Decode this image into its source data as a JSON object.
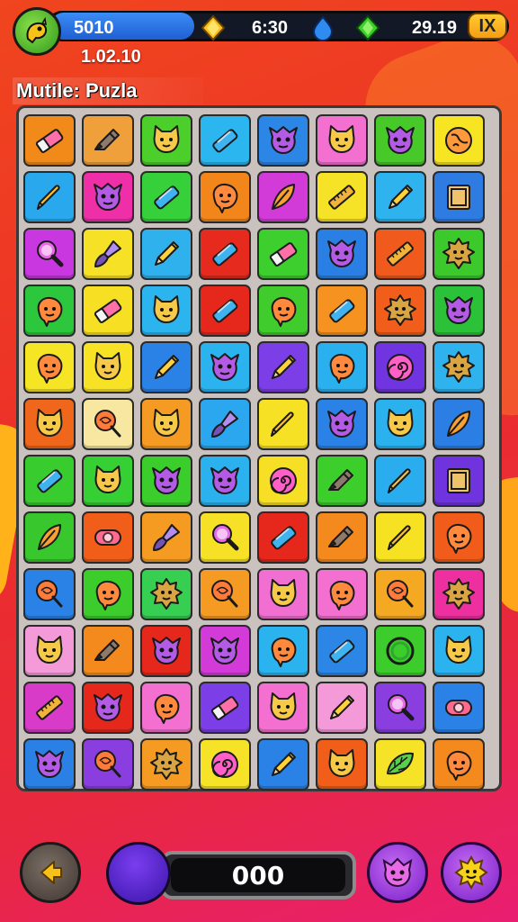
{
  "hud": {
    "score": "5010",
    "subscore": "1.02.10",
    "timer": "6:30",
    "gems": "29.19",
    "close_label": "IX"
  },
  "mode_title": "Mutile: Puzla",
  "board": {
    "rows": [
      [
        {
          "bg": "#f28a1a",
          "icon": "eraser-icon"
        },
        {
          "bg": "#f0a03a",
          "icon": "marker-icon"
        },
        {
          "bg": "#4ccf2a",
          "icon": "cat-face-icon"
        },
        {
          "bg": "#2bb6f0",
          "icon": "crayon-icon"
        },
        {
          "bg": "#2b86e6",
          "icon": "monster-icon"
        },
        {
          "bg": "#f36fd0",
          "icon": "cat-face-icon"
        },
        {
          "bg": "#48c92a",
          "icon": "monster-icon"
        },
        {
          "bg": "#f7e423",
          "icon": "globe-icon"
        }
      ],
      [
        {
          "bg": "#2aa8ee",
          "icon": "pen-icon"
        },
        {
          "bg": "#ee2fa8",
          "icon": "monster-icon"
        },
        {
          "bg": "#36d03a",
          "icon": "crayon-icon"
        },
        {
          "bg": "#f2861a",
          "icon": "blob-face-icon"
        },
        {
          "bg": "#d33bd8",
          "icon": "feather-icon"
        },
        {
          "bg": "#f6e226",
          "icon": "ruler-icon"
        },
        {
          "bg": "#2fb3ef",
          "icon": "pencil-icon"
        },
        {
          "bg": "#2e7be2",
          "icon": "book-icon"
        }
      ],
      [
        {
          "bg": "#c937e0",
          "icon": "magnifier-icon"
        },
        {
          "bg": "#f7e126",
          "icon": "brush-icon"
        },
        {
          "bg": "#2fb1ee",
          "icon": "pencil-icon"
        },
        {
          "bg": "#e62a1e",
          "icon": "crayon-icon"
        },
        {
          "bg": "#3ccf2e",
          "icon": "eraser-icon"
        },
        {
          "bg": "#2a7fe4",
          "icon": "monster-icon"
        },
        {
          "bg": "#f05a1c",
          "icon": "ruler-icon"
        },
        {
          "bg": "#3bc92c",
          "icon": "sun-face-icon"
        }
      ],
      [
        {
          "bg": "#2cc73c",
          "icon": "blob-face-icon"
        },
        {
          "bg": "#f7e023",
          "icon": "eraser-icon"
        },
        {
          "bg": "#2cb4ee",
          "icon": "cat-face-icon"
        },
        {
          "bg": "#e6281c",
          "icon": "crayon-icon"
        },
        {
          "bg": "#3fcc2c",
          "icon": "blob-face-icon"
        },
        {
          "bg": "#f59220",
          "icon": "crayon-icon"
        },
        {
          "bg": "#f15d1a",
          "icon": "sun-face-icon"
        },
        {
          "bg": "#2bc23a",
          "icon": "monster-icon"
        }
      ],
      [
        {
          "bg": "#f6e524",
          "icon": "blob-face-icon"
        },
        {
          "bg": "#f7e226",
          "icon": "cat-face-icon"
        },
        {
          "bg": "#2b82e6",
          "icon": "pencil-icon"
        },
        {
          "bg": "#2ab3ef",
          "icon": "monster-icon"
        },
        {
          "bg": "#7c3ee6",
          "icon": "pencil-icon"
        },
        {
          "bg": "#2ab0ee",
          "icon": "blob-face-icon"
        },
        {
          "bg": "#7035e0",
          "icon": "swirl-icon"
        },
        {
          "bg": "#2eb3ef",
          "icon": "sun-face-icon"
        }
      ],
      [
        {
          "bg": "#f0661a",
          "icon": "cat-face-icon"
        },
        {
          "bg": "#f7e7a0",
          "icon": "lollipop-icon"
        },
        {
          "bg": "#f59a22",
          "icon": "cat-face-icon"
        },
        {
          "bg": "#2aa7ee",
          "icon": "brush-icon"
        },
        {
          "bg": "#f6e125",
          "icon": "pen-icon"
        },
        {
          "bg": "#2b82e6",
          "icon": "monster-icon"
        },
        {
          "bg": "#2ab1ee",
          "icon": "cat-face-icon"
        },
        {
          "bg": "#2b7fe4",
          "icon": "feather-icon"
        }
      ],
      [
        {
          "bg": "#38cc2e",
          "icon": "crayon-icon"
        },
        {
          "bg": "#36cf34",
          "icon": "cat-face-icon"
        },
        {
          "bg": "#3acd2c",
          "icon": "monster-icon"
        },
        {
          "bg": "#2ab1ee",
          "icon": "monster-icon"
        },
        {
          "bg": "#f6df24",
          "icon": "swirl-icon"
        },
        {
          "bg": "#3ccf2c",
          "icon": "marker-icon"
        },
        {
          "bg": "#2aadee",
          "icon": "pen-icon"
        },
        {
          "bg": "#7034de",
          "icon": "book-icon"
        }
      ],
      [
        {
          "bg": "#38c72c",
          "icon": "feather-icon"
        },
        {
          "bg": "#f05e1a",
          "icon": "tape-icon"
        },
        {
          "bg": "#f59b22",
          "icon": "brush-icon"
        },
        {
          "bg": "#f6e126",
          "icon": "magnifier-icon"
        },
        {
          "bg": "#e6271c",
          "icon": "crayon-icon"
        },
        {
          "bg": "#f48a1e",
          "icon": "marker-icon"
        },
        {
          "bg": "#f6e223",
          "icon": "pen-icon"
        },
        {
          "bg": "#f15c1a",
          "icon": "blob-face-icon"
        }
      ],
      [
        {
          "bg": "#2a82e6",
          "icon": "lollipop-icon"
        },
        {
          "bg": "#3ccd2c",
          "icon": "blob-face-icon"
        },
        {
          "bg": "#36cf52",
          "icon": "sun-face-icon"
        },
        {
          "bg": "#f59a22",
          "icon": "lollipop-icon"
        },
        {
          "bg": "#f26fd2",
          "icon": "cat-face-icon"
        },
        {
          "bg": "#f36fd0",
          "icon": "blob-face-icon"
        },
        {
          "bg": "#f5a922",
          "icon": "lollipop-icon"
        },
        {
          "bg": "#ee2fa0",
          "icon": "sun-face-icon"
        }
      ],
      [
        {
          "bg": "#f59ad8",
          "icon": "cat-face-icon"
        },
        {
          "bg": "#f48a1e",
          "icon": "marker-icon"
        },
        {
          "bg": "#e6271c",
          "icon": "monster-icon"
        },
        {
          "bg": "#d33bd8",
          "icon": "monster-icon"
        },
        {
          "bg": "#2ab3ef",
          "icon": "blob-face-icon"
        },
        {
          "bg": "#2b86e6",
          "icon": "crayon-icon"
        },
        {
          "bg": "#3ccc2c",
          "icon": "ring-icon"
        },
        {
          "bg": "#2ab3ef",
          "icon": "cat-face-icon"
        }
      ],
      [
        {
          "bg": "#d83bc8",
          "icon": "ruler-icon"
        },
        {
          "bg": "#e6271c",
          "icon": "monster-icon"
        },
        {
          "bg": "#f36fd0",
          "icon": "blob-face-icon"
        },
        {
          "bg": "#7c3ee6",
          "icon": "eraser-icon"
        },
        {
          "bg": "#f36fd0",
          "icon": "cat-face-icon"
        },
        {
          "bg": "#f59ad8",
          "icon": "pencil-icon"
        },
        {
          "bg": "#8a3ee0",
          "icon": "magnifier-icon"
        },
        {
          "bg": "#2b82e6",
          "icon": "tape-icon"
        }
      ],
      [
        {
          "bg": "#2b80e6",
          "icon": "monster-icon"
        },
        {
          "bg": "#8a3ee0",
          "icon": "lollipop-icon"
        },
        {
          "bg": "#f59a22",
          "icon": "sun-face-icon"
        },
        {
          "bg": "#f6e226",
          "icon": "swirl-icon"
        },
        {
          "bg": "#2b82e6",
          "icon": "pencil-icon"
        },
        {
          "bg": "#f05e1a",
          "icon": "cat-face-icon"
        },
        {
          "bg": "#f6e226",
          "icon": "leaf-icon"
        },
        {
          "bg": "#f48a1e",
          "icon": "blob-face-icon"
        }
      ]
    ]
  },
  "controls": {
    "counter_value": "000"
  },
  "colors": {
    "hud_bar": "#121826",
    "score_pill": "#2f74e8",
    "close_button": "#f5b21c",
    "board_bg": "#c9c2be",
    "power_button": "#9b37dc"
  }
}
